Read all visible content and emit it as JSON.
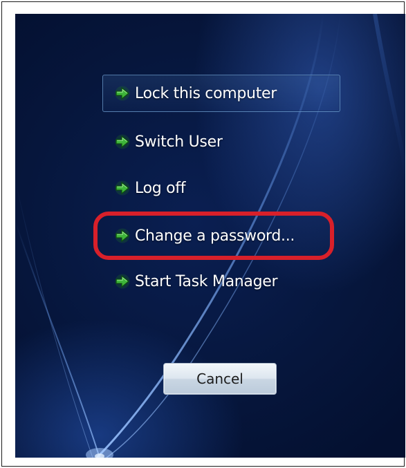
{
  "security_options": {
    "items": [
      {
        "label": "Lock this computer",
        "icon": "green-arrow-icon",
        "selected": true
      },
      {
        "label": "Switch User",
        "icon": "green-arrow-icon",
        "selected": false
      },
      {
        "label": "Log off",
        "icon": "green-arrow-icon",
        "selected": false
      },
      {
        "label": "Change a password...",
        "icon": "green-arrow-icon",
        "selected": false,
        "highlighted": true
      },
      {
        "label": "Start Task Manager",
        "icon": "green-arrow-icon",
        "selected": false
      }
    ],
    "cancel_label": "Cancel"
  },
  "colors": {
    "background": "#06163c",
    "accent_arrow": "#3fb53a",
    "highlight_ring": "#d8202a",
    "text": "#ffffff"
  }
}
